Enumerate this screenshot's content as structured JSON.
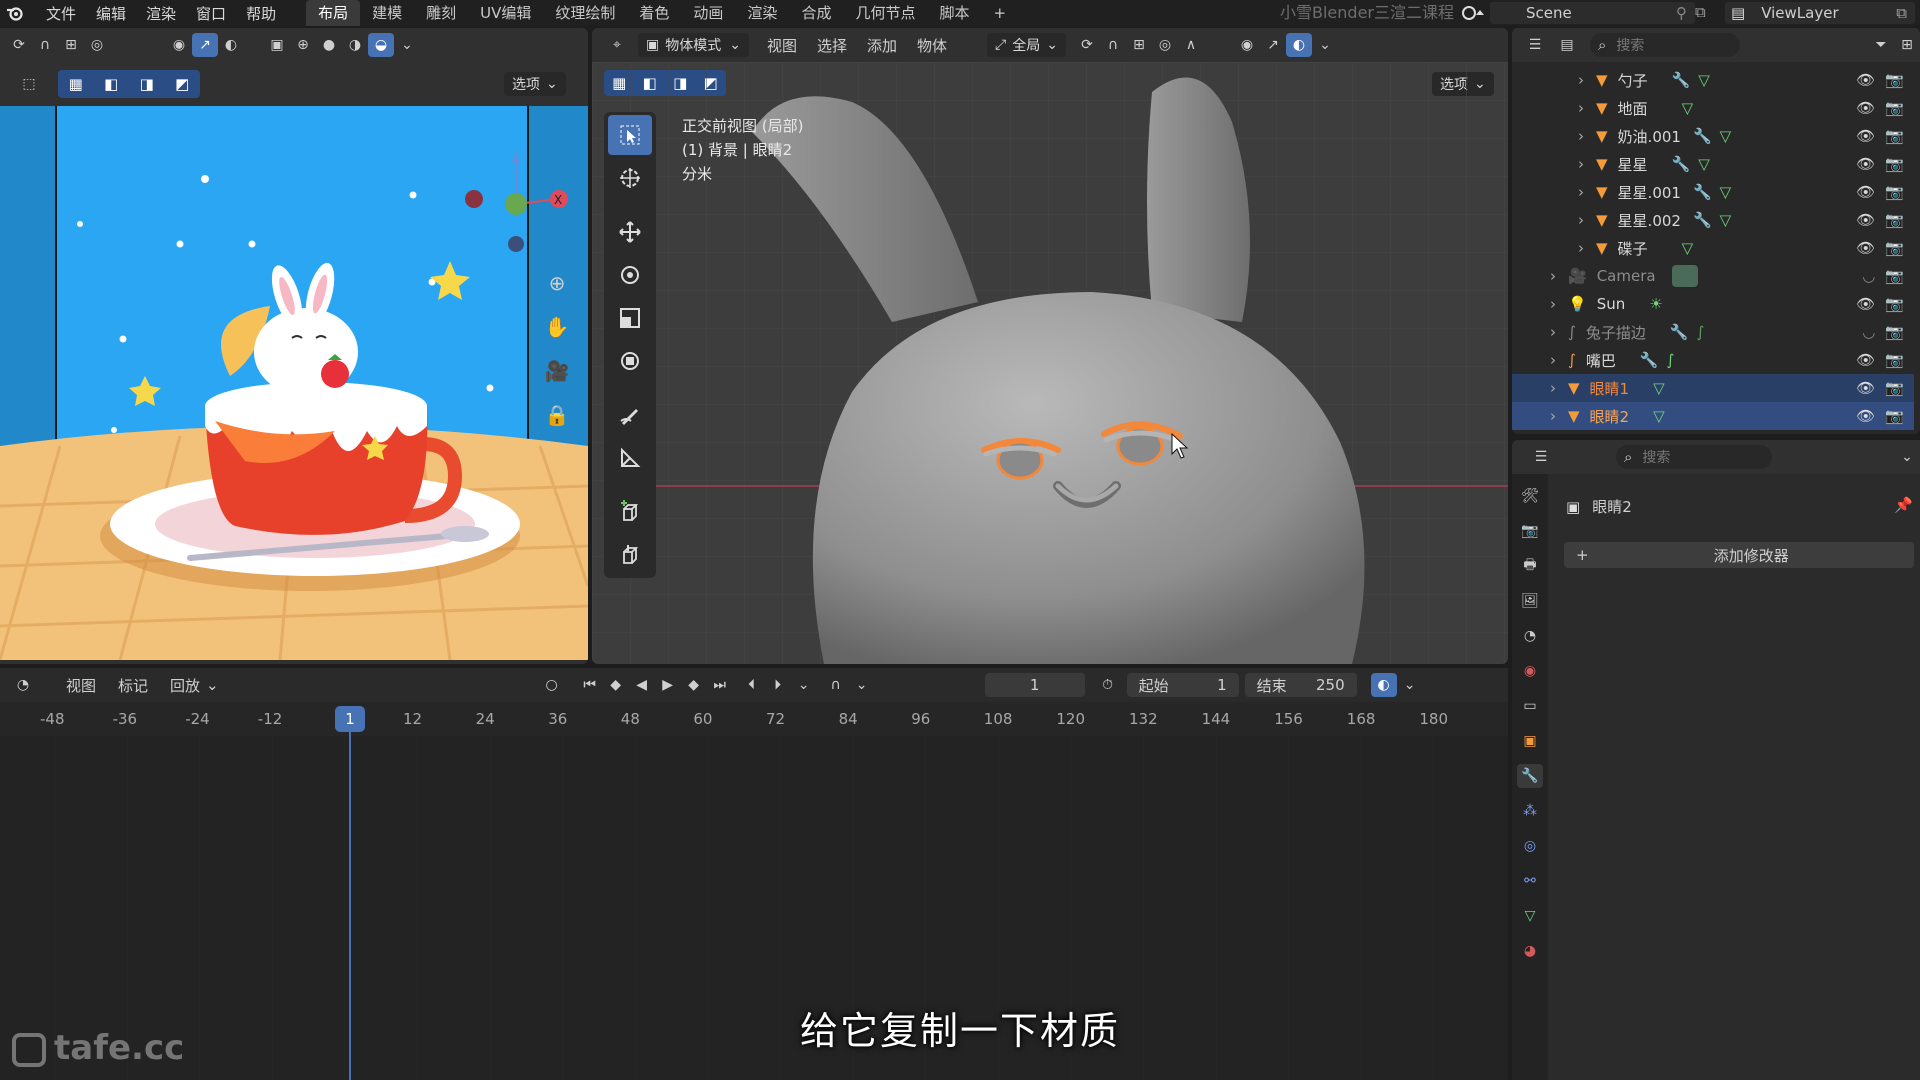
{
  "topbar": {
    "menus": [
      "文件",
      "编辑",
      "渲染",
      "窗口",
      "帮助"
    ],
    "workspaces": [
      "布局",
      "建模",
      "雕刻",
      "UV编辑",
      "纹理绘制",
      "着色",
      "动画",
      "渲染",
      "合成",
      "几何节点",
      "脚本"
    ],
    "active_workspace": "布局",
    "course_title": "小雪Blender三渲二课程",
    "scene": "Scene",
    "view_layer": "ViewLayer"
  },
  "left_view": {
    "options": "选项"
  },
  "main_view": {
    "mode": "物体模式",
    "menus": [
      "视图",
      "选择",
      "添加",
      "物体"
    ],
    "transform": "全局",
    "options": "选项",
    "info_line1": "正交前视图 (局部)",
    "info_line2": "(1) 背景 | 眼睛2",
    "info_line3": "分米"
  },
  "outliner": {
    "search_placeholder": "搜索",
    "items": [
      {
        "name": "勺子",
        "highlight": false
      },
      {
        "name": "地面",
        "highlight": false
      },
      {
        "name": "奶油.001",
        "highlight": false
      },
      {
        "name": "星星",
        "highlight": false
      },
      {
        "name": "星星.001",
        "highlight": false
      },
      {
        "name": "星星.002",
        "highlight": false
      },
      {
        "name": "碟子",
        "highlight": false
      },
      {
        "name": "Camera",
        "highlight": false
      },
      {
        "name": "Sun",
        "highlight": false
      },
      {
        "name": "兔子描边",
        "highlight": false
      },
      {
        "name": "嘴巴",
        "highlight": false
      },
      {
        "name": "眼睛1",
        "highlight": true
      },
      {
        "name": "眼睛2",
        "highlight": true
      }
    ]
  },
  "properties": {
    "search_placeholder": "搜索",
    "object_name": "眼睛2",
    "add_modifier": "添加修改器"
  },
  "timeline": {
    "menus": [
      "视图",
      "标记",
      "回放"
    ],
    "current_frame": "1",
    "start_label": "起始",
    "start": "1",
    "end_label": "结束",
    "end": "250",
    "ticks": [
      "-48",
      "-36",
      "-24",
      "-12",
      "1",
      "12",
      "24",
      "36",
      "48",
      "60",
      "72",
      "84",
      "96",
      "108",
      "120",
      "132",
      "144",
      "156",
      "168",
      "180"
    ]
  },
  "subtitle": "给它复制一下材质",
  "watermark": "tafe.cc",
  "colors": {
    "accent": "#4772b3",
    "selection": "#334d80",
    "orange": "#f3873a",
    "ground": "#f2c27b",
    "sky": "#2aa6f2"
  }
}
